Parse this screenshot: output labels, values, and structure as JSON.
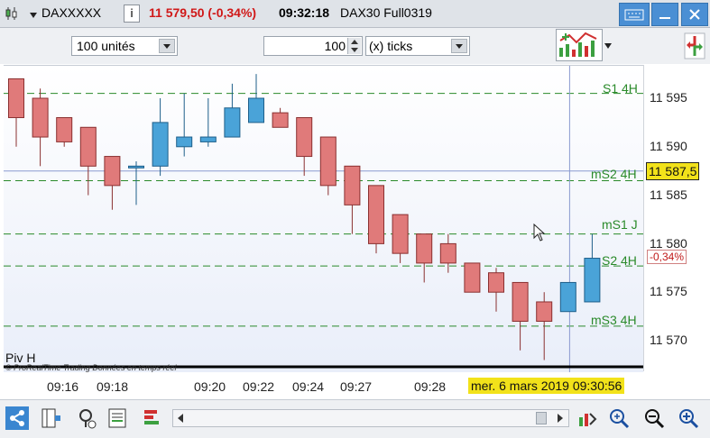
{
  "header": {
    "symbol": "DAXXXXX",
    "info_label": "i",
    "price_change": "11 579,50 (-0,34%)",
    "time": "09:32:18",
    "instrument": "DAX30 Full0319"
  },
  "toolbar": {
    "units_value": "100 unités",
    "ticks_count": "100",
    "ticks_unit": "(x) ticks"
  },
  "colors": {
    "bull": "#4aa3d8",
    "bear": "#e07a7a",
    "level": "#2a8a2a",
    "price_tag": "#f2e21a"
  },
  "chart": {
    "y_ticks": [
      "11 595",
      "11 590",
      "11 585",
      "11 580",
      "11 575",
      "11 570"
    ],
    "x_ticks": [
      "09:16",
      "09:18",
      "09:20",
      "09:22",
      "09:24",
      "09:27",
      "09:28"
    ],
    "current_price": "11 587,5",
    "change_tag": "-0,34%",
    "date_time": "mer. 6 mars 2019 09:30:56",
    "indicator_label": "Piv H",
    "copyright": "© ProRealTime Trading  Données en temps réel",
    "levels": [
      "S1 4H",
      "mS2 4H",
      "mS1 J",
      "S2 4H",
      "mS3 4H"
    ]
  },
  "chart_data": {
    "type": "candlestick",
    "y_range": [
      11566,
      11599
    ],
    "candles": [
      {
        "o": 11597,
        "h": 11597,
        "l": 11590,
        "c": 11593
      },
      {
        "o": 11595,
        "h": 11596,
        "l": 11588,
        "c": 11591
      },
      {
        "o": 11593,
        "h": 11593,
        "l": 11590,
        "c": 11590.5
      },
      {
        "o": 11592,
        "h": 11592,
        "l": 11585,
        "c": 11588
      },
      {
        "o": 11589,
        "h": 11589,
        "l": 11583.5,
        "c": 11586
      },
      {
        "o": 11588,
        "h": 11588.5,
        "l": 11584,
        "c": 11588
      },
      {
        "o": 11588,
        "h": 11595,
        "l": 11587,
        "c": 11592.5
      },
      {
        "o": 11590,
        "h": 11595.5,
        "l": 11589,
        "c": 11591
      },
      {
        "o": 11590.5,
        "h": 11595,
        "l": 11590,
        "c": 11591
      },
      {
        "o": 11591,
        "h": 11596.5,
        "l": 11591,
        "c": 11594
      },
      {
        "o": 11592.5,
        "h": 11597.5,
        "l": 11592.5,
        "c": 11595
      },
      {
        "o": 11593.5,
        "h": 11594,
        "l": 11592,
        "c": 11592
      },
      {
        "o": 11593,
        "h": 11593,
        "l": 11587,
        "c": 11589
      },
      {
        "o": 11591,
        "h": 11591,
        "l": 11585,
        "c": 11586
      },
      {
        "o": 11588,
        "h": 11588,
        "l": 11581,
        "c": 11584
      },
      {
        "o": 11586,
        "h": 11586,
        "l": 11579,
        "c": 11580
      },
      {
        "o": 11583,
        "h": 11583,
        "l": 11578,
        "c": 11579
      },
      {
        "o": 11581,
        "h": 11581,
        "l": 11576,
        "c": 11578
      },
      {
        "o": 11580,
        "h": 11581,
        "l": 11577,
        "c": 11578
      },
      {
        "o": 11578,
        "h": 11578,
        "l": 11575,
        "c": 11575
      },
      {
        "o": 11577,
        "h": 11577.5,
        "l": 11573,
        "c": 11575
      },
      {
        "o": 11576,
        "h": 11576,
        "l": 11569,
        "c": 11572
      },
      {
        "o": 11574,
        "h": 11575,
        "l": 11568,
        "c": 11572
      },
      {
        "o": 11573,
        "h": 11576,
        "l": 11573,
        "c": 11576
      },
      {
        "o": 11574,
        "h": 11581,
        "l": 11574,
        "c": 11578.5
      }
    ],
    "levels": [
      {
        "name": "S1 4H",
        "value": 11595.5
      },
      {
        "name": "mS2 4H",
        "value": 11586.5
      },
      {
        "name": "mS1 J",
        "value": 11581
      },
      {
        "name": "S2 4H",
        "value": 11577.7
      },
      {
        "name": "mS3 4H",
        "value": 11571.5
      }
    ],
    "current_price": 11587.5
  }
}
